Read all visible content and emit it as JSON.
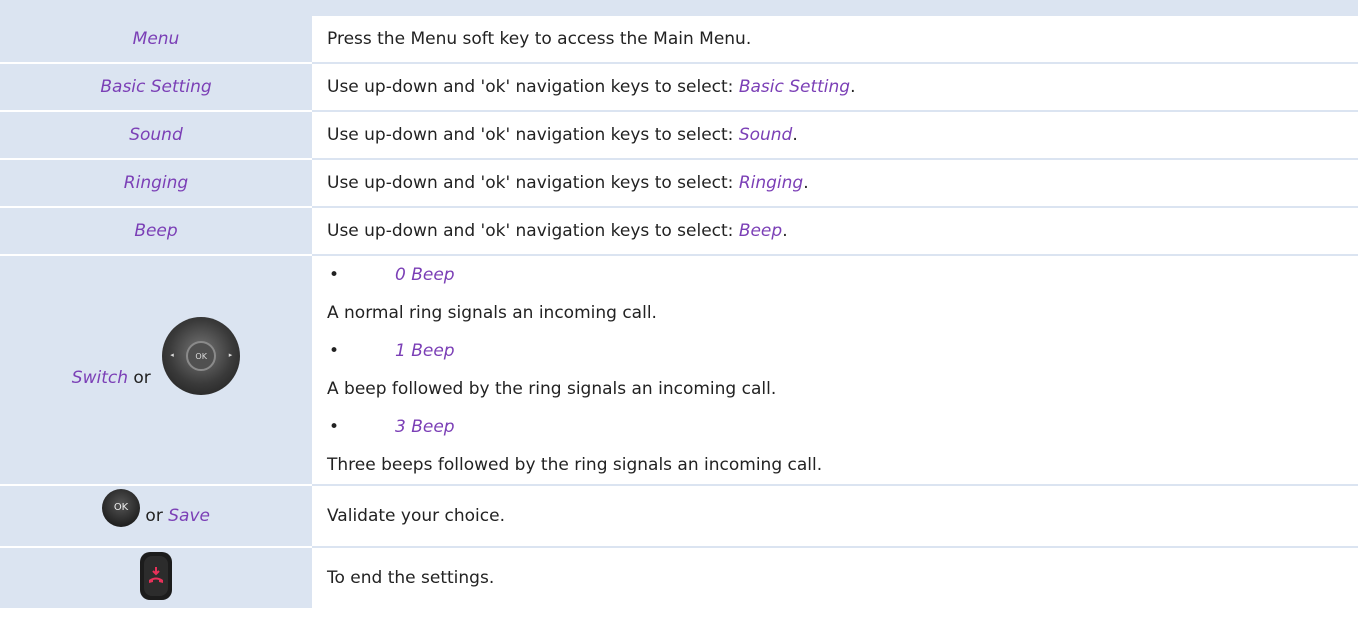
{
  "rows": [
    {
      "action": "Menu",
      "desc": "Press the Menu soft key to access the Main Menu."
    },
    {
      "action": "Basic Setting",
      "desc_prefix": "Use up-down and 'ok' navigation keys to select: ",
      "desc_key": "Basic Setting",
      "desc_suffix": "."
    },
    {
      "action": "Sound",
      "desc_prefix": "Use up-down and 'ok' navigation keys to select: ",
      "desc_key": "Sound",
      "desc_suffix": "."
    },
    {
      "action": "Ringing",
      "desc_prefix": "Use up-down and 'ok' navigation keys to select: ",
      "desc_key": "Ringing",
      "desc_suffix": "."
    },
    {
      "action": "Beep",
      "desc_prefix": "Use up-down and 'ok' navigation keys to select: ",
      "desc_key": "Beep",
      "desc_suffix": "."
    }
  ],
  "switch_row": {
    "action_key": "Switch",
    "action_or": " or",
    "nav_key_label": "OK",
    "options": [
      {
        "bullet": "•",
        "label": "0 Beep",
        "text": "A normal ring signals an incoming call."
      },
      {
        "bullet": "•",
        "label": "1 Beep",
        "text": "A beep followed by the ring signals an incoming call."
      },
      {
        "bullet": "•",
        "label": "3 Beep",
        "text": "Three beeps followed by the ring signals an incoming call."
      }
    ]
  },
  "ok_row": {
    "ok_key_label": "OK",
    "action_or": " or ",
    "action_key": "Save",
    "desc": "Validate your choice."
  },
  "end_row": {
    "desc": "To end the settings."
  },
  "colors": {
    "accent": "#7b3fb6",
    "band": "#dbe4f1",
    "end_key_icon": "#e8315a"
  }
}
